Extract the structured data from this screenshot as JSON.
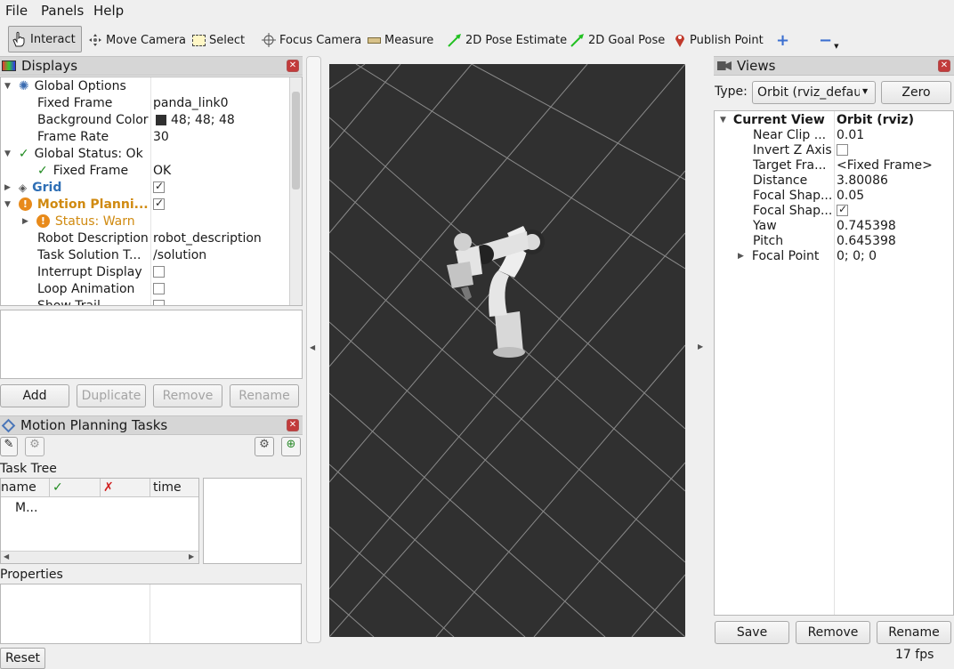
{
  "menu": {
    "file": "File",
    "panels": "Panels",
    "help": "Help"
  },
  "toolbar": {
    "interact": "Interact",
    "move_camera": "Move Camera",
    "select": "Select",
    "focus_camera": "Focus Camera",
    "measure": "Measure",
    "pose_estimate": "2D Pose Estimate",
    "goal_pose": "2D Goal Pose",
    "publish_point": "Publish Point"
  },
  "displays": {
    "title": "Displays",
    "global_options": "Global Options",
    "fixed_frame_label": "Fixed Frame",
    "fixed_frame_value": "panda_link0",
    "bg_color_label": "Background Color",
    "bg_color_value": "48; 48; 48",
    "bg_color_swatch": "#303030",
    "frame_rate_label": "Frame Rate",
    "frame_rate_value": "30",
    "global_status": "Global Status: Ok",
    "status_fixed_frame": "Fixed Frame",
    "status_fixed_frame_value": "OK",
    "grid": "Grid",
    "motion_planning": "Motion Planni...",
    "status_warn": "Status: Warn",
    "robot_desc_label": "Robot Description",
    "robot_desc_value": "robot_description",
    "task_solution_label": "Task Solution T...",
    "task_solution_value": "/solution",
    "interrupt_display": "Interrupt Display",
    "loop_animation": "Loop Animation",
    "show_trail": "Show Trail",
    "buttons": {
      "add": "Add",
      "duplicate": "Duplicate",
      "remove": "Remove",
      "rename": "Rename"
    }
  },
  "mpt": {
    "title": "Motion Planning Tasks",
    "task_tree": "Task Tree",
    "col_name": "name",
    "col_ok": "✓",
    "col_fail": "✗",
    "col_time": "time",
    "row1": "M...",
    "properties": "Properties"
  },
  "views": {
    "title": "Views",
    "type_label": "Type:",
    "type_value": "Orbit (rviz_defau",
    "zero": "Zero",
    "current_view": "Current View",
    "current_view_value": "Orbit (rviz)",
    "near_clip": "Near Clip ...",
    "near_clip_value": "0.01",
    "invert_z": "Invert Z Axis",
    "target_frame": "Target Fra...",
    "target_frame_value": "<Fixed Frame>",
    "distance": "Distance",
    "distance_value": "3.80086",
    "focal_shape1": "Focal Shap...",
    "focal_shape1_value": "0.05",
    "focal_shape2": "Focal Shap...",
    "yaw": "Yaw",
    "yaw_value": "0.745398",
    "pitch": "Pitch",
    "pitch_value": "0.645398",
    "focal_point": "Focal Point",
    "focal_point_value": "0; 0; 0",
    "buttons": {
      "save": "Save",
      "remove": "Remove",
      "rename": "Rename"
    }
  },
  "status_bar": {
    "reset": "Reset",
    "fps": "17 fps"
  },
  "colors": {
    "accent_blue": "#2f6fb5",
    "warn_orange": "#d08a10",
    "viewport_bg": "#303030",
    "ok_green": "#1f8a1f",
    "fail_red": "#d02020"
  }
}
